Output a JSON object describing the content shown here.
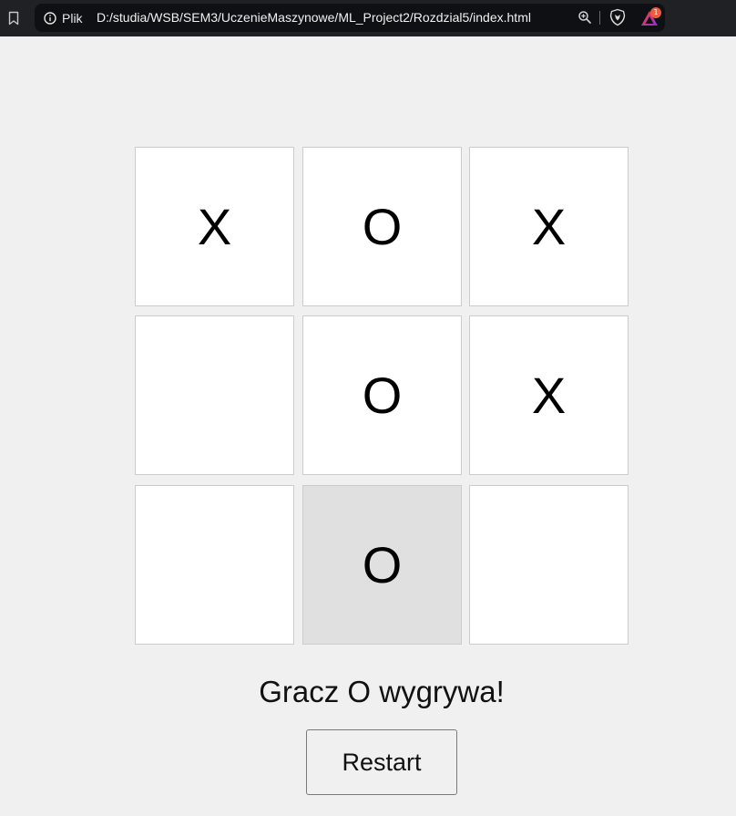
{
  "browser": {
    "site_info_label": "Plik",
    "url": "D:/studia/WSB/SEM3/UczenieMaszynowe/ML_Project2/Rozdzial5/index.html",
    "notification_count": "1",
    "icons": [
      "bookmark-icon",
      "info-icon",
      "zoom-icon",
      "brave-shield-icon",
      "brave-rewards-icon"
    ]
  },
  "game": {
    "cells": [
      "X",
      "O",
      "X",
      "",
      "O",
      "X",
      "",
      "O",
      ""
    ],
    "status": "Gracz O wygrywa!",
    "restart_label": "Restart"
  },
  "colors": {
    "page_background": "#f0f0f0",
    "cell_background": "#ffffff",
    "cell_hover_background": "#e0e0e0",
    "cell_border": "#cccccc",
    "toolbar_background": "#202124"
  }
}
